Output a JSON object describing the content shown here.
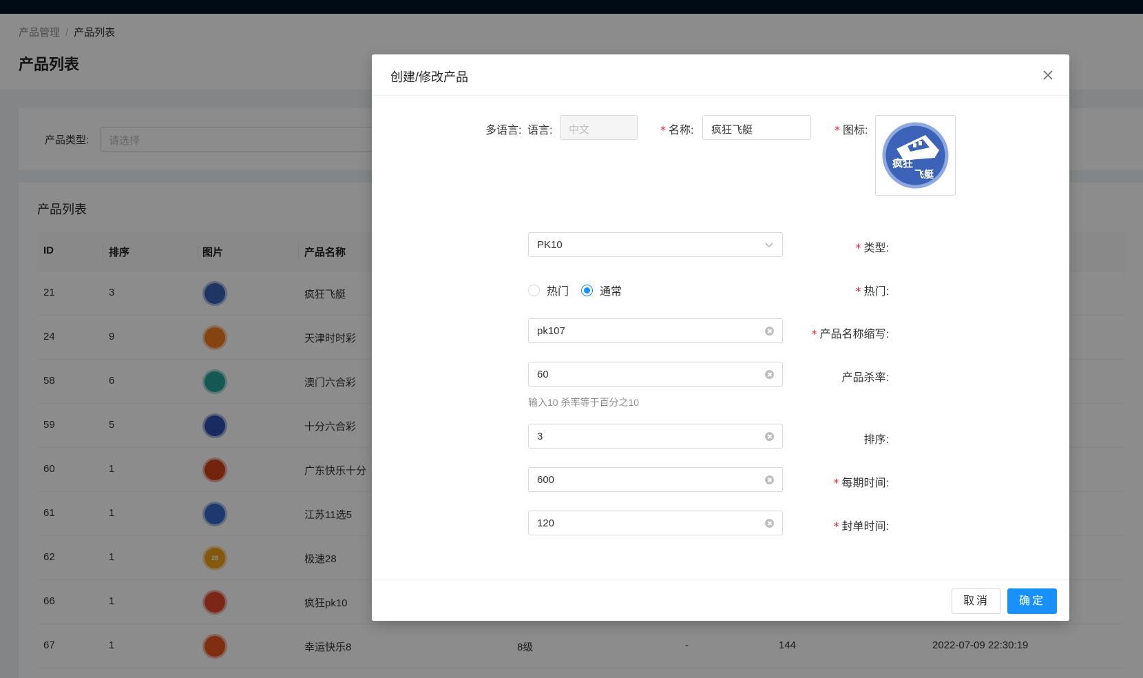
{
  "breadcrumb": {
    "parent": "产品管理",
    "separator": "/",
    "current": "产品列表"
  },
  "page_title": "产品列表",
  "filter": {
    "label": "产品类型:",
    "placeholder": "请选择"
  },
  "table": {
    "title": "产品列表",
    "headers": {
      "id": "ID",
      "sort": "排序",
      "image": "图片",
      "name": "产品名称"
    },
    "rows": [
      {
        "id": "21",
        "sort": "3",
        "name": "疯狂飞艇",
        "icon_color": "#3a62b5",
        "icon_text": ""
      },
      {
        "id": "24",
        "sort": "9",
        "name": "天津时时彩",
        "icon_color": "#f07a1e",
        "icon_text": ""
      },
      {
        "id": "58",
        "sort": "6",
        "name": "澳门六合彩",
        "icon_color": "#28a39a",
        "icon_text": ""
      },
      {
        "id": "59",
        "sort": "5",
        "name": "十分六合彩",
        "icon_color": "#2f4fb0",
        "icon_text": ""
      },
      {
        "id": "60",
        "sort": "1",
        "name": "广东快乐十分",
        "icon_color": "#d1421b",
        "icon_text": ""
      },
      {
        "id": "61",
        "sort": "1",
        "name": "江苏11选5",
        "icon_color": "#3869c9",
        "icon_text": ""
      },
      {
        "id": "62",
        "sort": "1",
        "name": "极速28",
        "icon_color": "#f0a21c",
        "icon_text": "28"
      },
      {
        "id": "66",
        "sort": "1",
        "name": "疯狂pk10",
        "icon_color": "#e0462a",
        "icon_text": ""
      },
      {
        "id": "67",
        "sort": "1",
        "name": "幸运快乐8",
        "icon_color": "#e8561e",
        "icon_text": "",
        "level": "8级",
        "dash": "-",
        "count": "144",
        "time": "2022-07-09 22:30:19"
      }
    ]
  },
  "modal": {
    "title": "创建/修改产品",
    "multilang_label": "多语言:",
    "lang_label": "语言:",
    "lang_value": "中文",
    "name_label": "名称:",
    "name_value": "疯狂飞艇",
    "icon_label": "图标:",
    "icon_text_top": "疯狂",
    "icon_text_bottom": "飞艇",
    "type_label": "类型:",
    "type_value": "PK10",
    "hot_label": "热门:",
    "hot_options": [
      "热门",
      "通常"
    ],
    "hot_selected": "通常",
    "abbr_label": "产品名称缩写:",
    "abbr_value": "pk107",
    "kill_label": "产品杀率:",
    "kill_value": "60",
    "kill_hint": "输入10 杀率等于百分之10",
    "sort_label": "排序:",
    "sort_value": "3",
    "period_label": "每期时间:",
    "period_value": "600",
    "close_label": "封单时间:",
    "close_value": "120",
    "cancel_label": "取消",
    "ok_label": "确定"
  },
  "colors": {
    "primary": "#1890ff",
    "required": "#f5222d",
    "topbar": "#001529"
  }
}
